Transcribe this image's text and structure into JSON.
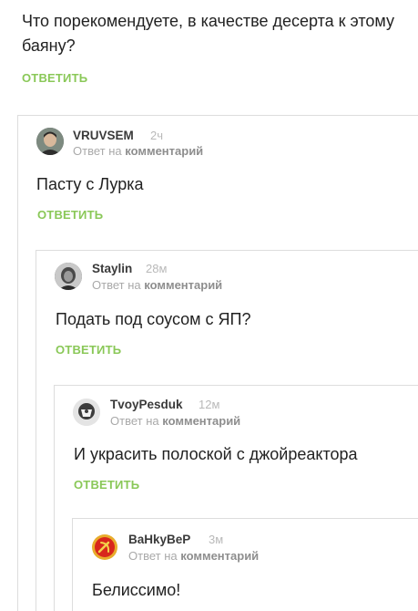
{
  "root": {
    "text": "Что порекомендуете, в качестве десерта к этому баяну?",
    "reply_label": "ОТВЕТИТЬ"
  },
  "comments": [
    {
      "author": "VRUVSEM",
      "time": "2ч",
      "meta_prefix": "Ответ на",
      "meta_link": "комментарий",
      "text": "Пасту с Лурка",
      "reply_label": "ОТВЕТИТЬ"
    },
    {
      "author": "Staylin",
      "time": "28м",
      "meta_prefix": "Ответ на",
      "meta_link": "комментарий",
      "text": "Подать под соусом с ЯП?",
      "reply_label": "ОТВЕТИТЬ"
    },
    {
      "author": "TvoyPesduk",
      "time": "12м",
      "meta_prefix": "Ответ на",
      "meta_link": "комментарий",
      "text": "И украсить полоской с джойреактора",
      "reply_label": "ОТВЕТИТЬ"
    },
    {
      "author": "BaHkyBeP",
      "time": "3м",
      "meta_prefix": "Ответ на",
      "meta_link": "комментарий",
      "text": "Белиссимо!"
    }
  ],
  "colors": {
    "accent": "#8ac858",
    "thread_line": "#dddddd"
  },
  "icons": [
    "user-avatar",
    "user-avatar",
    "user-avatar",
    "hammer-sickle-avatar"
  ]
}
